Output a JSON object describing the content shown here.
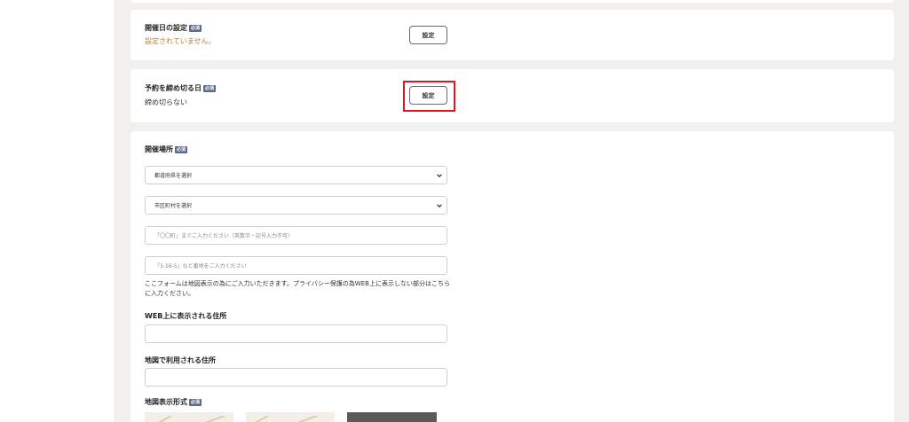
{
  "event_date": {
    "title": "開催日の設定",
    "required_badge": "必須",
    "status": "設定されていません。",
    "button_label": "設定"
  },
  "deadline": {
    "title": "予約を締め切る日",
    "required_badge": "必須",
    "status": "締め切らない",
    "button_label": "設定"
  },
  "venue": {
    "title": "開催場所",
    "required_badge": "必須",
    "prefecture_select": "都道府県を選択",
    "city_select": "市区町村を選択",
    "town_placeholder": "「〇〇町」までご入力ください（英数字・記号入力不可）",
    "address_placeholder": "「3-16-5」など番地をご入力ください",
    "note": "ここフォームは地図表示の為にご入力いただきます。プライバシー保護の為WEB上に表示しない部分はこちらに入力ください。",
    "web_address_label": "WEB上に表示される住所",
    "web_address_value": "",
    "map_address_label": "地図で利用される住所",
    "map_address_value": "",
    "map_format_label": "地図表示形式",
    "map_format_badge": "必須"
  },
  "colors": {
    "highlight": "#e0141e",
    "badge": "#5b6b8a",
    "warning": "#c07a2a",
    "background": "#f2f0ee"
  }
}
